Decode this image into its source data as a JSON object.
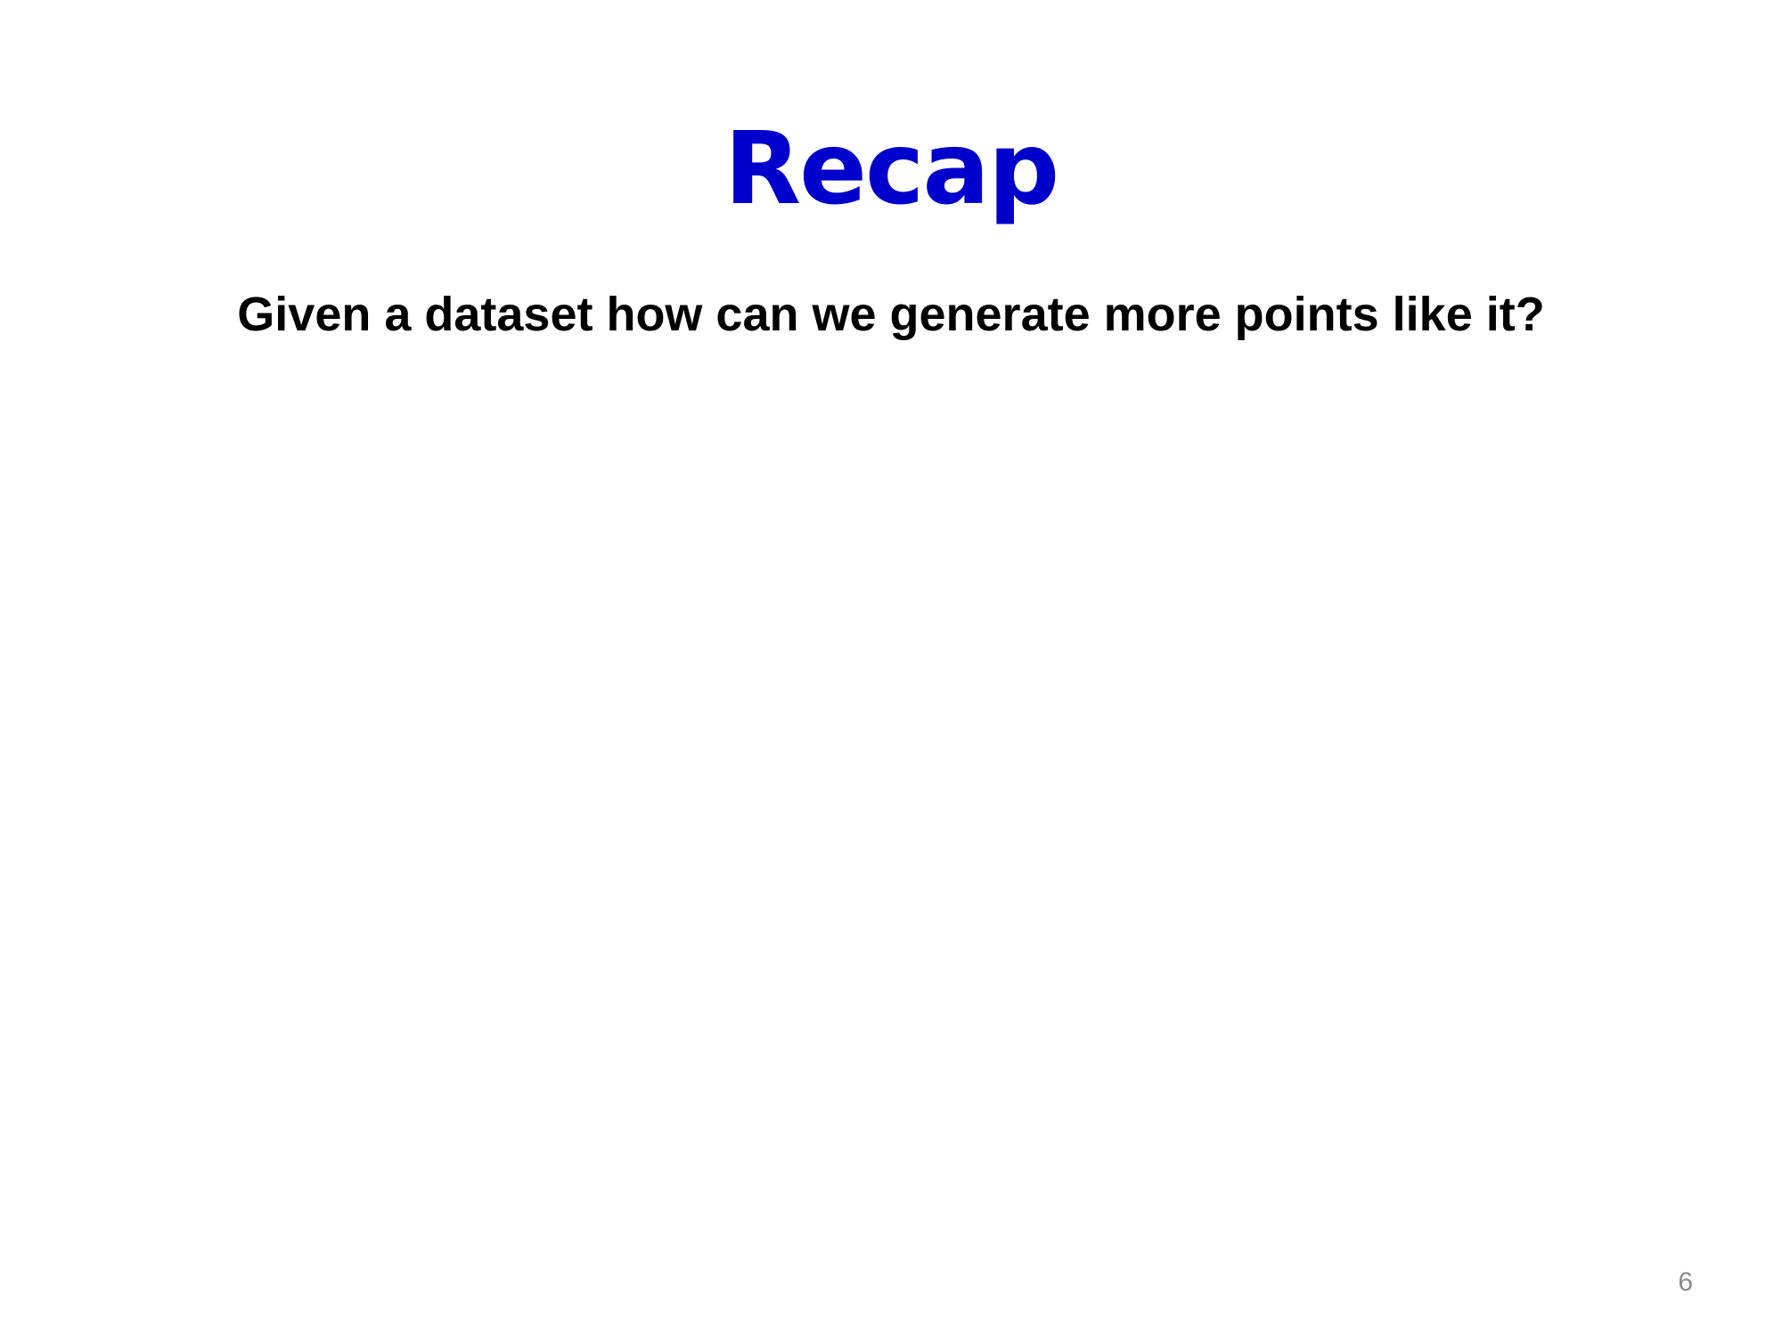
{
  "slide": {
    "title": "Recap",
    "subtitle": "Given a dataset how can we generate more points like it?",
    "page_number": "6"
  },
  "colors": {
    "title": "#0000cc",
    "subtitle": "#000000",
    "page_number": "#8a8a8a",
    "background": "#ffffff"
  }
}
